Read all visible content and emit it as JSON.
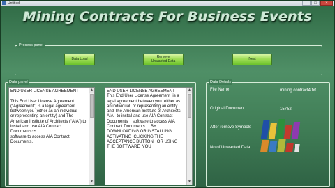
{
  "window": {
    "title": "Untitled"
  },
  "header": {
    "title": "Mining Contracts For Business Events"
  },
  "process_panel": {
    "label": "Process panel",
    "buttons": {
      "data_load": "Data Load",
      "remove_unwanted": "Remove\nUnwanted Data",
      "next": "Next"
    }
  },
  "data_panel": {
    "label": "Data panel",
    "text1": "END USER LICENSE AGREEMENT\n\nThis End User License Agreement (“Agreement”) is a legal agreement between you (either as an individual\nor representing an entity) and The American Institute of Architects (“AIA”) to install and use AIA Contract Documents™\nsoftware to access AIA Contract Documents.",
    "text2": "END USER LICENSE AGREEMENT\nThis End User License Agreement  is a legal agreement between you  either as an individual  or representing an entity  and The American Institute of Architects   AIA   to install and use AIA Contract Documents    software to access AIA Contract Documents.    BY DOWNLOADING OR INSTALLING ACTIVATING  CLICKING THE ACCEPTANCE BUTTON   OR USING THE SOFTWARE  YOU"
  },
  "data_details": {
    "label": "Data Details",
    "file_name_label": "File Name",
    "file_name_value": "mining contract4.txt",
    "original_doc_label": "Original Document",
    "original_doc_value": "15752",
    "after_remove_label": "After remove Symbols",
    "unwanted_label": "No of Unwanted Data"
  },
  "colors": {
    "background": "#3f7c55",
    "button_green": "#9fdd57",
    "panel_border": "#d6ecd9"
  },
  "icons": [
    "window-icon",
    "minimize-icon",
    "maximize-icon",
    "close-icon",
    "scroll-up-icon",
    "scroll-down-icon",
    "decorative-logo-icon"
  ]
}
